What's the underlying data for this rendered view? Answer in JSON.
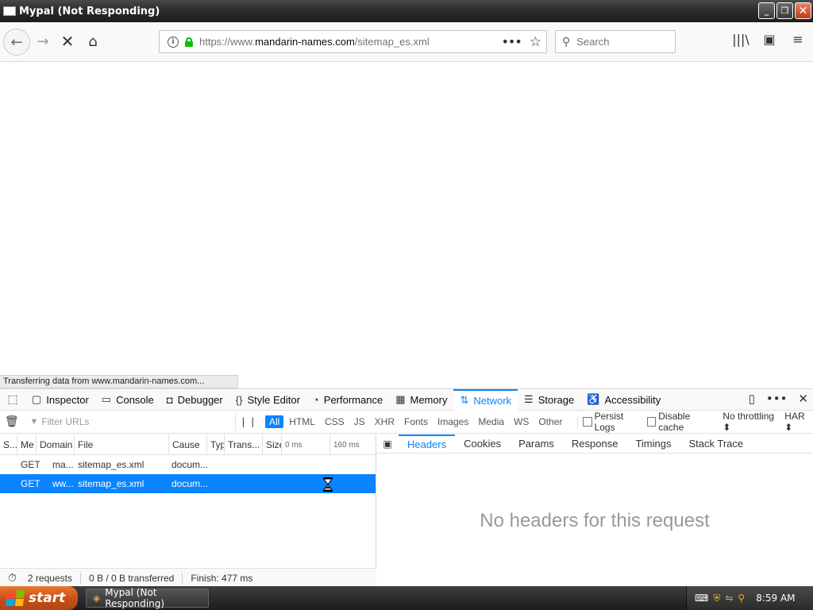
{
  "window": {
    "title": "Mypal (Not Responding)",
    "min": "_",
    "max": "❐",
    "close": "✕"
  },
  "nav": {
    "back": "←",
    "forward": "→",
    "stop": "✕",
    "home": "⌂",
    "url_prefix": "https://www.",
    "url_domain": "mandarin-names.com",
    "url_path": "/sitemap_es.xml",
    "search_placeholder": "Search",
    "page_actions": "•••",
    "bookmark_star": "☆",
    "library_icon": "|||\\",
    "sidebar_icon": "▣",
    "menu_icon": "≡"
  },
  "status": {
    "text": "Transferring data from www.mandarin-names.com..."
  },
  "devtools": {
    "picker_icon": "⬚",
    "tabs": [
      {
        "label": "Inspector",
        "icon": "▢"
      },
      {
        "label": "Console",
        "icon": "▭"
      },
      {
        "label": "Debugger",
        "icon": "◘"
      },
      {
        "label": "Style Editor",
        "icon": "{}"
      },
      {
        "label": "Performance",
        "icon": "◔"
      },
      {
        "label": "Memory",
        "icon": "▦"
      },
      {
        "label": "Network",
        "icon": "⇅"
      },
      {
        "label": "Storage",
        "icon": "☰"
      },
      {
        "label": "Accessibility",
        "icon": "♿"
      }
    ],
    "active_tab": "Network",
    "tools": {
      "dock": "▯",
      "more": "•••",
      "close": "✕"
    }
  },
  "network": {
    "filter_placeholder": "Filter URLs",
    "pause": "| |",
    "type_filters": [
      "All",
      "HTML",
      "CSS",
      "JS",
      "XHR",
      "Fonts",
      "Images",
      "Media",
      "WS",
      "Other"
    ],
    "active_filter": "All",
    "persist_logs": "Persist Logs",
    "disable_cache": "Disable cache",
    "throttling": "No throttling ⬍",
    "har": "HAR ⬍",
    "columns": [
      "S...",
      "Me",
      "Domain",
      "File",
      "Cause",
      "Typ",
      "Trans...",
      "Size",
      "0 ms",
      "160 ms"
    ],
    "requests": [
      {
        "method": "GET",
        "domain": "ma...",
        "file": "sitemap_es.xml",
        "cause": "docum..."
      },
      {
        "method": "GET",
        "domain": "ww...",
        "file": "sitemap_es.xml",
        "cause": "docum..."
      }
    ],
    "footer": {
      "count": "2 requests",
      "transferred": "0 B / 0 B transferred",
      "finish": "Finish: 477 ms"
    },
    "detail_tabs": [
      "Headers",
      "Cookies",
      "Params",
      "Response",
      "Timings",
      "Stack Trace"
    ],
    "active_detail_tab": "Headers",
    "empty_message": "No headers for this request"
  },
  "taskbar": {
    "start": "start",
    "task": "Mypal (Not Responding)",
    "clock": "8:59 AM"
  },
  "colors": {
    "accent": "#0a84ff",
    "lock": "#12bc00",
    "start": "#c9501c"
  }
}
